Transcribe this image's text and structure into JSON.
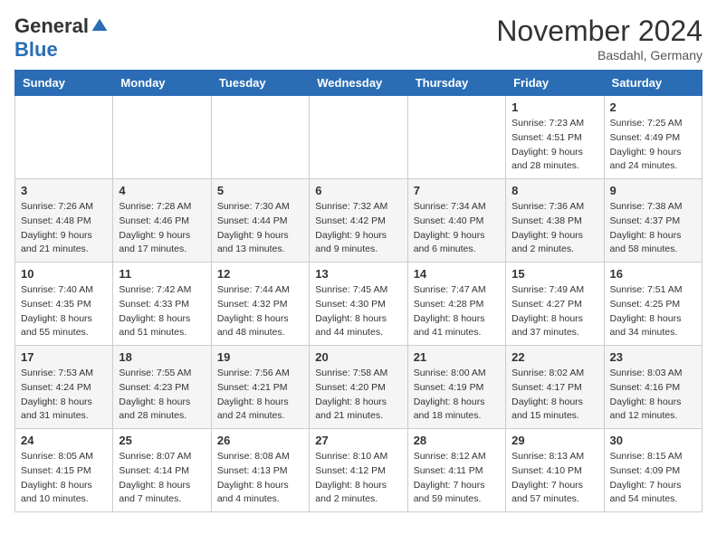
{
  "header": {
    "logo_general": "General",
    "logo_blue": "Blue",
    "month_title": "November 2024",
    "location": "Basdahl, Germany"
  },
  "days_of_week": [
    "Sunday",
    "Monday",
    "Tuesday",
    "Wednesday",
    "Thursday",
    "Friday",
    "Saturday"
  ],
  "weeks": [
    [
      {
        "day": "",
        "info": ""
      },
      {
        "day": "",
        "info": ""
      },
      {
        "day": "",
        "info": ""
      },
      {
        "day": "",
        "info": ""
      },
      {
        "day": "",
        "info": ""
      },
      {
        "day": "1",
        "info": "Sunrise: 7:23 AM\nSunset: 4:51 PM\nDaylight: 9 hours and 28 minutes."
      },
      {
        "day": "2",
        "info": "Sunrise: 7:25 AM\nSunset: 4:49 PM\nDaylight: 9 hours and 24 minutes."
      }
    ],
    [
      {
        "day": "3",
        "info": "Sunrise: 7:26 AM\nSunset: 4:48 PM\nDaylight: 9 hours and 21 minutes."
      },
      {
        "day": "4",
        "info": "Sunrise: 7:28 AM\nSunset: 4:46 PM\nDaylight: 9 hours and 17 minutes."
      },
      {
        "day": "5",
        "info": "Sunrise: 7:30 AM\nSunset: 4:44 PM\nDaylight: 9 hours and 13 minutes."
      },
      {
        "day": "6",
        "info": "Sunrise: 7:32 AM\nSunset: 4:42 PM\nDaylight: 9 hours and 9 minutes."
      },
      {
        "day": "7",
        "info": "Sunrise: 7:34 AM\nSunset: 4:40 PM\nDaylight: 9 hours and 6 minutes."
      },
      {
        "day": "8",
        "info": "Sunrise: 7:36 AM\nSunset: 4:38 PM\nDaylight: 9 hours and 2 minutes."
      },
      {
        "day": "9",
        "info": "Sunrise: 7:38 AM\nSunset: 4:37 PM\nDaylight: 8 hours and 58 minutes."
      }
    ],
    [
      {
        "day": "10",
        "info": "Sunrise: 7:40 AM\nSunset: 4:35 PM\nDaylight: 8 hours and 55 minutes."
      },
      {
        "day": "11",
        "info": "Sunrise: 7:42 AM\nSunset: 4:33 PM\nDaylight: 8 hours and 51 minutes."
      },
      {
        "day": "12",
        "info": "Sunrise: 7:44 AM\nSunset: 4:32 PM\nDaylight: 8 hours and 48 minutes."
      },
      {
        "day": "13",
        "info": "Sunrise: 7:45 AM\nSunset: 4:30 PM\nDaylight: 8 hours and 44 minutes."
      },
      {
        "day": "14",
        "info": "Sunrise: 7:47 AM\nSunset: 4:28 PM\nDaylight: 8 hours and 41 minutes."
      },
      {
        "day": "15",
        "info": "Sunrise: 7:49 AM\nSunset: 4:27 PM\nDaylight: 8 hours and 37 minutes."
      },
      {
        "day": "16",
        "info": "Sunrise: 7:51 AM\nSunset: 4:25 PM\nDaylight: 8 hours and 34 minutes."
      }
    ],
    [
      {
        "day": "17",
        "info": "Sunrise: 7:53 AM\nSunset: 4:24 PM\nDaylight: 8 hours and 31 minutes."
      },
      {
        "day": "18",
        "info": "Sunrise: 7:55 AM\nSunset: 4:23 PM\nDaylight: 8 hours and 28 minutes."
      },
      {
        "day": "19",
        "info": "Sunrise: 7:56 AM\nSunset: 4:21 PM\nDaylight: 8 hours and 24 minutes."
      },
      {
        "day": "20",
        "info": "Sunrise: 7:58 AM\nSunset: 4:20 PM\nDaylight: 8 hours and 21 minutes."
      },
      {
        "day": "21",
        "info": "Sunrise: 8:00 AM\nSunset: 4:19 PM\nDaylight: 8 hours and 18 minutes."
      },
      {
        "day": "22",
        "info": "Sunrise: 8:02 AM\nSunset: 4:17 PM\nDaylight: 8 hours and 15 minutes."
      },
      {
        "day": "23",
        "info": "Sunrise: 8:03 AM\nSunset: 4:16 PM\nDaylight: 8 hours and 12 minutes."
      }
    ],
    [
      {
        "day": "24",
        "info": "Sunrise: 8:05 AM\nSunset: 4:15 PM\nDaylight: 8 hours and 10 minutes."
      },
      {
        "day": "25",
        "info": "Sunrise: 8:07 AM\nSunset: 4:14 PM\nDaylight: 8 hours and 7 minutes."
      },
      {
        "day": "26",
        "info": "Sunrise: 8:08 AM\nSunset: 4:13 PM\nDaylight: 8 hours and 4 minutes."
      },
      {
        "day": "27",
        "info": "Sunrise: 8:10 AM\nSunset: 4:12 PM\nDaylight: 8 hours and 2 minutes."
      },
      {
        "day": "28",
        "info": "Sunrise: 8:12 AM\nSunset: 4:11 PM\nDaylight: 7 hours and 59 minutes."
      },
      {
        "day": "29",
        "info": "Sunrise: 8:13 AM\nSunset: 4:10 PM\nDaylight: 7 hours and 57 minutes."
      },
      {
        "day": "30",
        "info": "Sunrise: 8:15 AM\nSunset: 4:09 PM\nDaylight: 7 hours and 54 minutes."
      }
    ]
  ]
}
